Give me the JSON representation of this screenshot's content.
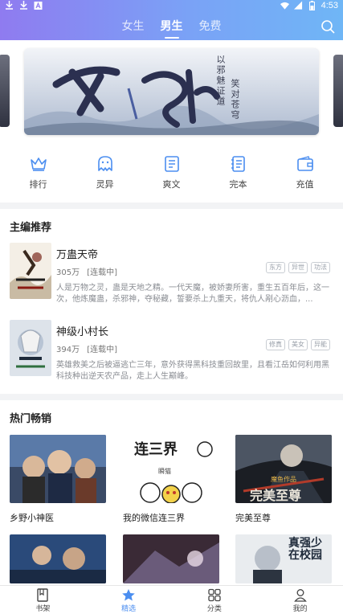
{
  "status_bar": {
    "time": "4:53",
    "left_icons": [
      "download-icon",
      "download-icon",
      "app-a-icon"
    ],
    "right_icons": [
      "wifi-icon",
      "signal-icon",
      "battery-icon"
    ]
  },
  "top_tabs": [
    {
      "label": "女生",
      "active": false
    },
    {
      "label": "男生",
      "active": true
    },
    {
      "label": "免费",
      "active": false
    }
  ],
  "banner": {
    "calligraphy": "邪神",
    "caption_1": "以邪魅证道",
    "caption_2": "笑对苍穹"
  },
  "categories": [
    {
      "label": "排行",
      "icon": "crown-icon"
    },
    {
      "label": "灵异",
      "icon": "ghost-icon"
    },
    {
      "label": "爽文",
      "icon": "book-icon"
    },
    {
      "label": "完本",
      "icon": "notebook-icon"
    },
    {
      "label": "充值",
      "icon": "wallet-icon"
    }
  ],
  "editor_picks": {
    "title": "主编推荐",
    "items": [
      {
        "title": "万蛊天帝",
        "count": "305万",
        "status": "[连载中]",
        "tags": [
          "东方",
          "异世",
          "功法"
        ],
        "desc": "人是万物之灵，蛊是天地之精。一代天魔，被娇妻所害，重生五百年后，这一次，他炼魔蛊，杀邪神，夺秘藏，誓要杀上九重天，将仇人剐心沥血，..."
      },
      {
        "title": "神级小村长",
        "count": "394万",
        "status": "[连载中]",
        "tags": [
          "修真",
          "美女",
          "异能"
        ],
        "desc": "英雄救美之后被逼逃亡三年，意外获得黑科技重回故里，且看江岳如何利用黑科技种出逆天农产品，走上人生巅峰。"
      }
    ]
  },
  "hot_sales": {
    "title": "热门畅销",
    "items": [
      {
        "title": "乡野小神医"
      },
      {
        "title": "我的微信连三界"
      },
      {
        "title": "完美至尊"
      }
    ],
    "cover_texts": {
      "lian_san_jie": "连三界",
      "author": "瞬猫",
      "wanmei": "完美至尊",
      "publisher": "魔鱼作品",
      "row2_third": "真强少在校园"
    }
  },
  "bottom_nav": [
    {
      "label": "书架",
      "icon": "bookshelf-icon",
      "active": false
    },
    {
      "label": "精选",
      "icon": "star-icon",
      "active": true
    },
    {
      "label": "分类",
      "icon": "grid-icon",
      "active": false
    },
    {
      "label": "我的",
      "icon": "user-icon",
      "active": false
    }
  ],
  "colors": {
    "accent": "#4b8ef0",
    "header_start": "#8f7bf0",
    "header_end": "#6fb6f6"
  }
}
